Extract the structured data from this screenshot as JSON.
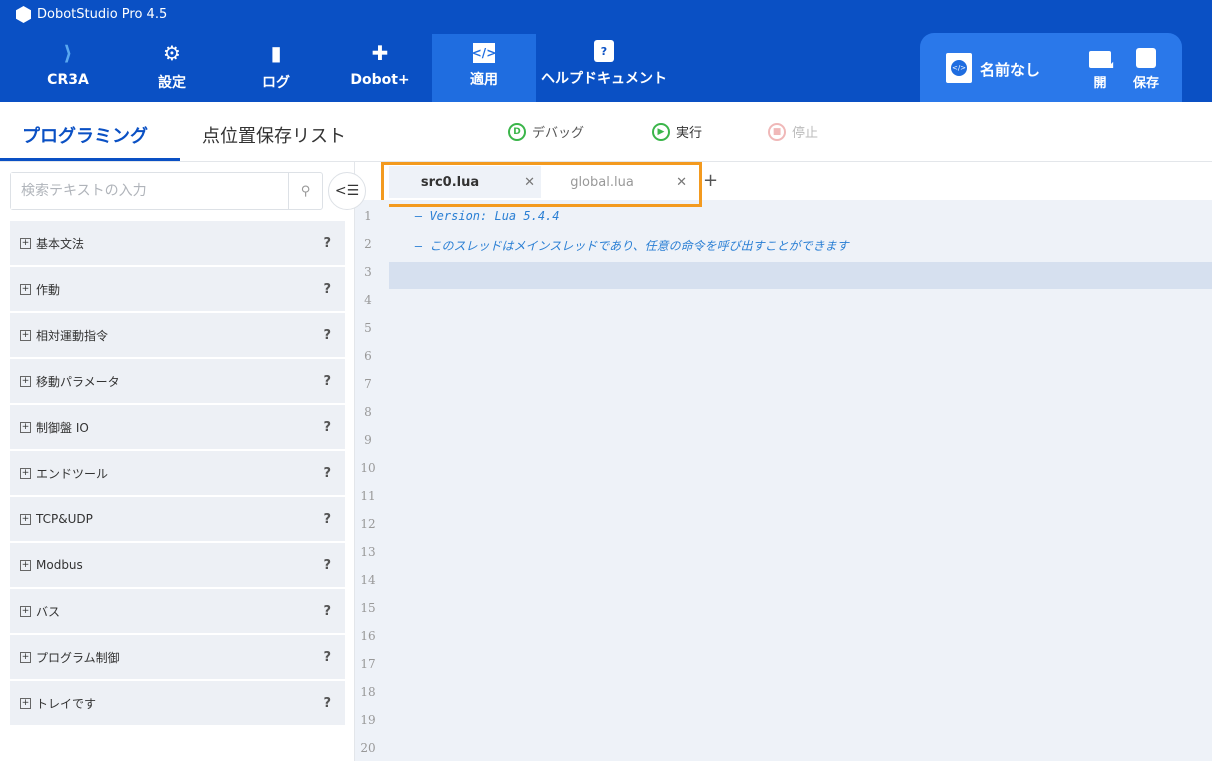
{
  "app": {
    "title": "DobotStudio Pro 4.5"
  },
  "nav": [
    {
      "label": "CR3A",
      "icon": "robot-arm-icon"
    },
    {
      "label": "設定",
      "icon": "gear-icon"
    },
    {
      "label": "ログ",
      "icon": "log-book-icon"
    },
    {
      "label": "Dobot+",
      "icon": "puzzle-icon"
    },
    {
      "label": "適用",
      "icon": "code-app-icon",
      "active": true
    },
    {
      "label": "ヘルプドキュメント",
      "icon": "help-doc-icon"
    }
  ],
  "project": {
    "name": "名前なし",
    "open_label": "開",
    "save_label": "保存"
  },
  "subtabs": [
    {
      "label": "プログラミング",
      "active": true
    },
    {
      "label": "点位置保存リスト"
    }
  ],
  "toolbar": {
    "debug": "デバッグ",
    "run": "実行",
    "stop": "停止"
  },
  "sidebar": {
    "search_placeholder": "検索テキストの入力",
    "items": [
      "基本文法",
      "作動",
      "相対運動指令",
      "移動パラメータ",
      "制御盤 IO",
      "エンドツール",
      "TCP&UDP",
      "Modbus",
      "バス",
      "プログラム制御",
      "トレイです"
    ],
    "help": "?"
  },
  "editor": {
    "tabs": [
      {
        "label": "src0.lua",
        "active": true
      },
      {
        "label": "global.lua"
      }
    ],
    "lines": [
      "— Version: Lua 5.4.4",
      "— このスレッドはメインスレッドであり、任意の命令を呼び出すことができます",
      ""
    ],
    "line_numbers": [
      "1",
      "2",
      "3",
      "4",
      "5",
      "6",
      "7",
      "8",
      "9",
      "10",
      "11",
      "12",
      "13",
      "14",
      "15",
      "16",
      "17",
      "18",
      "19",
      "20"
    ]
  },
  "colors": {
    "header": "#0a50c4",
    "accent": "#0a50c4",
    "highlight_box": "#f39a1f",
    "comment": "#2a7fd4"
  }
}
